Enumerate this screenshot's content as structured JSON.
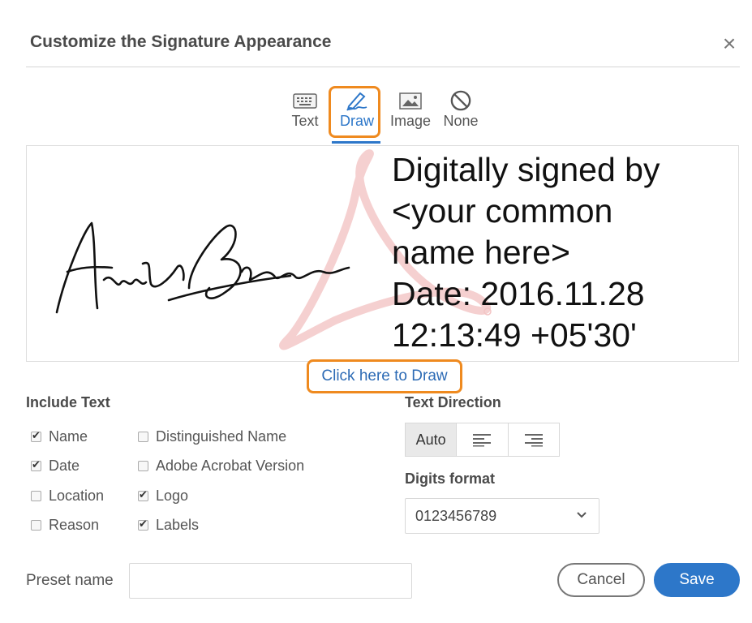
{
  "dialog": {
    "title": "Customize the Signature Appearance",
    "close_symbol": "×"
  },
  "tabs": [
    {
      "label": "Text",
      "icon": "keyboard-icon"
    },
    {
      "label": "Draw",
      "icon": "pen-icon",
      "active": true
    },
    {
      "label": "Image",
      "icon": "image-icon"
    },
    {
      "label": "None",
      "icon": "no-entry-icon"
    }
  ],
  "preview": {
    "signature_text": "Digitally signed by\n<your common\nname here>\nDate: 2016.11.28\n12:13:49 +05'30'",
    "handwritten_name": "Annie Brown",
    "watermark": "acrobat-logo"
  },
  "click_here_label": "Click here to Draw",
  "include_text": {
    "heading": "Include Text",
    "options": [
      {
        "label": "Name",
        "checked": true
      },
      {
        "label": "Date",
        "checked": true
      },
      {
        "label": "Location",
        "checked": false
      },
      {
        "label": "Reason",
        "checked": false
      },
      {
        "label": "Distinguished Name",
        "checked": false
      },
      {
        "label": "Adobe Acrobat Version",
        "checked": false
      },
      {
        "label": "Logo",
        "checked": true
      },
      {
        "label": "Labels",
        "checked": true
      }
    ]
  },
  "text_direction": {
    "heading": "Text Direction",
    "auto_label": "Auto",
    "selected": "Auto"
  },
  "digits_format": {
    "heading": "Digits format",
    "value": "0123456789"
  },
  "preset": {
    "label": "Preset name",
    "value": ""
  },
  "buttons": {
    "cancel": "Cancel",
    "save": "Save"
  },
  "colors": {
    "accent": "#2d77c9",
    "highlight": "#ef8a1f"
  }
}
